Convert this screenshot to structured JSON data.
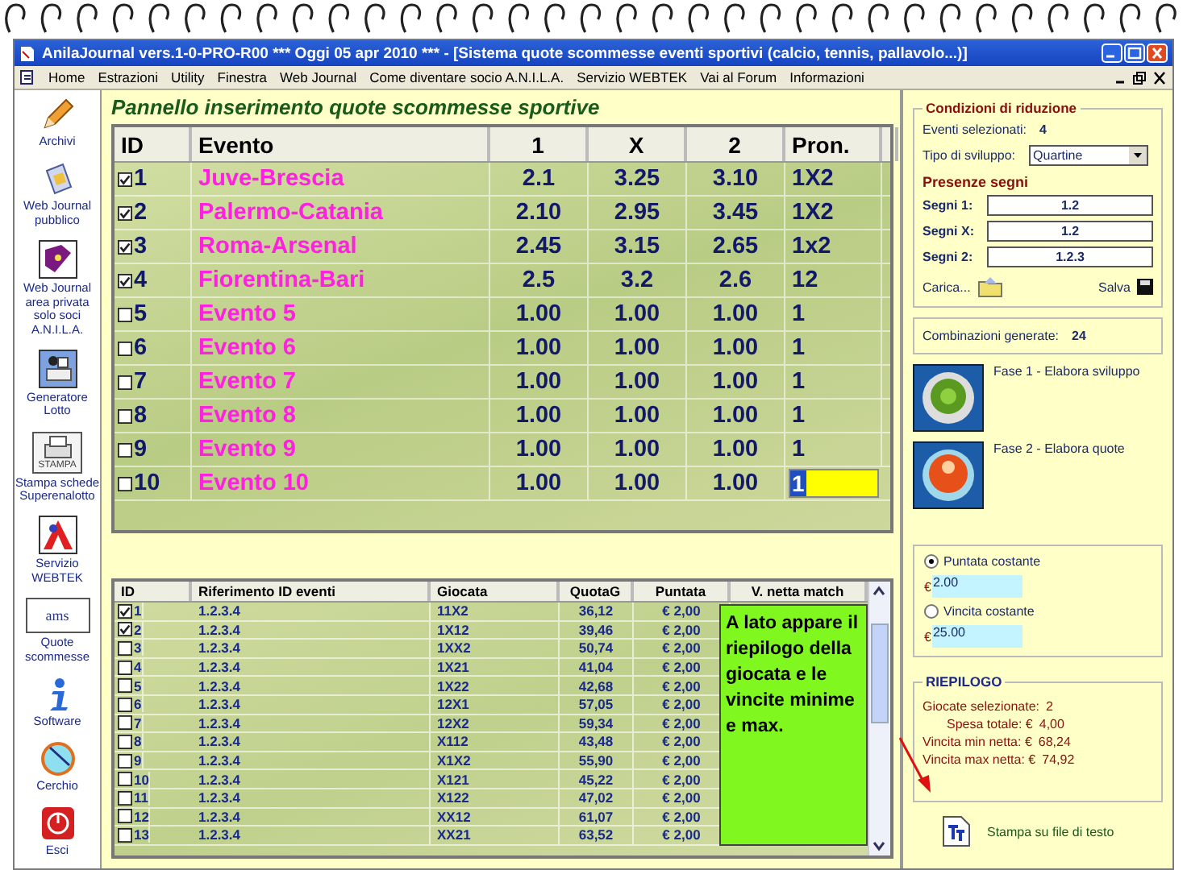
{
  "window": {
    "title": "AnilaJournal vers.1-0-PRO-R00  ***  Oggi 05 apr 2010  ***   - [Sistema quote scommesse eventi sportivi (calcio, tennis, pallavolo...)]"
  },
  "menu": [
    "Home",
    "Estrazioni",
    "Utility",
    "Finestra",
    "Web Journal",
    "Come diventare socio A.N.I.L.A.",
    "Servizio WEBTEK",
    "Vai al Forum",
    "Informazioni"
  ],
  "sidebar": [
    {
      "label": "Archivi"
    },
    {
      "label": "Web Journal pubblico"
    },
    {
      "label": "Web Journal area privata solo soci A.N.I.L.A."
    },
    {
      "label": "Generatore Lotto"
    },
    {
      "label": "Stampa schede Superenalotto",
      "icon_text": "STAMPA"
    },
    {
      "label": "Servizio WEBTEK"
    },
    {
      "label": "Quote scommesse",
      "icon_text": "ams"
    },
    {
      "label": "Software"
    },
    {
      "label": "Cerchio"
    },
    {
      "label": "Esci"
    }
  ],
  "panel_title": "Pannello inserimento quote scommesse sportive",
  "events": {
    "columns": [
      "ID",
      "Evento",
      "1",
      "X",
      "2",
      "Pron."
    ],
    "rows": [
      {
        "checked": true,
        "focused": false,
        "id": "1",
        "event": "Juve-Brescia",
        "q1": "2.1",
        "qx": "3.25",
        "q2": "3.10",
        "pron": "1X2"
      },
      {
        "checked": true,
        "focused": false,
        "id": "2",
        "event": "Palermo-Catania",
        "q1": "2.10",
        "qx": "2.95",
        "q2": "3.45",
        "pron": "1X2"
      },
      {
        "checked": true,
        "focused": false,
        "id": "3",
        "event": "Roma-Arsenal",
        "q1": "2.45",
        "qx": "3.15",
        "q2": "2.65",
        "pron": "1x2"
      },
      {
        "checked": true,
        "focused": false,
        "id": "4",
        "event": "Fiorentina-Bari",
        "q1": "2.5",
        "qx": "3.2",
        "q2": "2.6",
        "pron": "12"
      },
      {
        "checked": false,
        "focused": false,
        "id": "5",
        "event": "Evento 5",
        "q1": "1.00",
        "qx": "1.00",
        "q2": "1.00",
        "pron": "1"
      },
      {
        "checked": false,
        "focused": false,
        "id": "6",
        "event": "Evento 6",
        "q1": "1.00",
        "qx": "1.00",
        "q2": "1.00",
        "pron": "1"
      },
      {
        "checked": false,
        "focused": false,
        "id": "7",
        "event": "Evento 7",
        "q1": "1.00",
        "qx": "1.00",
        "q2": "1.00",
        "pron": "1"
      },
      {
        "checked": false,
        "focused": false,
        "id": "8",
        "event": "Evento 8",
        "q1": "1.00",
        "qx": "1.00",
        "q2": "1.00",
        "pron": "1"
      },
      {
        "checked": false,
        "focused": false,
        "id": "9",
        "event": "Evento 9",
        "q1": "1.00",
        "qx": "1.00",
        "q2": "1.00",
        "pron": "1"
      },
      {
        "checked": false,
        "focused": true,
        "id": "10",
        "event": "Evento 10",
        "q1": "1.00",
        "qx": "1.00",
        "q2": "1.00",
        "pron": "1"
      }
    ]
  },
  "reduction": {
    "title": "Condizioni di riduzione",
    "selected_label": "Eventi selezionati:",
    "selected_value": "4",
    "type_label": "Tipo di sviluppo:",
    "type_value": "Quartine",
    "presence_title": "Presenze segni",
    "signs": [
      {
        "label": "Segni 1:",
        "value": "1.2"
      },
      {
        "label": "Segni X:",
        "value": "1.2"
      },
      {
        "label": "Segni 2:",
        "value": "1.2.3"
      }
    ],
    "load": "Carica...",
    "save": "Salva"
  },
  "combinations": {
    "label": "Combinazioni generate:",
    "value": "24"
  },
  "phases": [
    {
      "label": "Fase 1 - Elabora sviluppo",
      "kind": "gear"
    },
    {
      "label": "Fase 2 - Elabora quote",
      "kind": "burst"
    }
  ],
  "bets": {
    "columns": [
      "ID",
      "Riferimento ID eventi",
      "Giocata",
      "QuotaG",
      "Puntata",
      "V. netta match"
    ],
    "rows": [
      {
        "checked": true,
        "id": "1",
        "ref": "1.2.3.4",
        "bet": "11X2",
        "quota": "36,12",
        "stake": "€ 2,00"
      },
      {
        "checked": true,
        "id": "2",
        "ref": "1.2.3.4",
        "bet": "1X12",
        "quota": "39,46",
        "stake": "€ 2,00"
      },
      {
        "checked": false,
        "id": "3",
        "ref": "1.2.3.4",
        "bet": "1XX2",
        "quota": "50,74",
        "stake": "€ 2,00"
      },
      {
        "checked": false,
        "id": "4",
        "ref": "1.2.3.4",
        "bet": "1X21",
        "quota": "41,04",
        "stake": "€ 2,00"
      },
      {
        "checked": false,
        "id": "5",
        "ref": "1.2.3.4",
        "bet": "1X22",
        "quota": "42,68",
        "stake": "€ 2,00"
      },
      {
        "checked": false,
        "id": "6",
        "ref": "1.2.3.4",
        "bet": "12X1",
        "quota": "57,05",
        "stake": "€ 2,00"
      },
      {
        "checked": false,
        "id": "7",
        "ref": "1.2.3.4",
        "bet": "12X2",
        "quota": "59,34",
        "stake": "€ 2,00"
      },
      {
        "checked": false,
        "id": "8",
        "ref": "1.2.3.4",
        "bet": "X112",
        "quota": "43,48",
        "stake": "€ 2,00"
      },
      {
        "checked": false,
        "id": "9",
        "ref": "1.2.3.4",
        "bet": "X1X2",
        "quota": "55,90",
        "stake": "€ 2,00"
      },
      {
        "checked": false,
        "id": "10",
        "ref": "1.2.3.4",
        "bet": "X121",
        "quota": "45,22",
        "stake": "€ 2,00"
      },
      {
        "checked": false,
        "id": "11",
        "ref": "1.2.3.4",
        "bet": "X122",
        "quota": "47,02",
        "stake": "€ 2,00"
      },
      {
        "checked": false,
        "id": "12",
        "ref": "1.2.3.4",
        "bet": "XX12",
        "quota": "61,07",
        "stake": "€ 2,00"
      },
      {
        "checked": false,
        "id": "13",
        "ref": "1.2.3.4",
        "bet": "XX21",
        "quota": "63,52",
        "stake": "€ 2,00"
      }
    ]
  },
  "note": "A lato appare il riepilogo della giocata e le vincite minime e max.",
  "stake_modes": [
    {
      "label": "Puntata costante",
      "selected": true,
      "currency": "€",
      "value": "2.00"
    },
    {
      "label": "Vincita costante",
      "selected": false,
      "currency": "€",
      "value": "25.00"
    }
  ],
  "summary": {
    "title": "RIEPILOGO",
    "lines": [
      {
        "label": "Giocate selezionate:",
        "value": "2",
        "kind": "plain"
      },
      {
        "label": "Spesa totale: €",
        "value": "4,00",
        "kind": "indent"
      },
      {
        "label": "Vincita min netta: €",
        "value": "68,24",
        "kind": "plain"
      },
      {
        "label": "Vincita max netta: €",
        "value": "74,92",
        "kind": "plain"
      }
    ]
  },
  "print": "Stampa su file di testo"
}
